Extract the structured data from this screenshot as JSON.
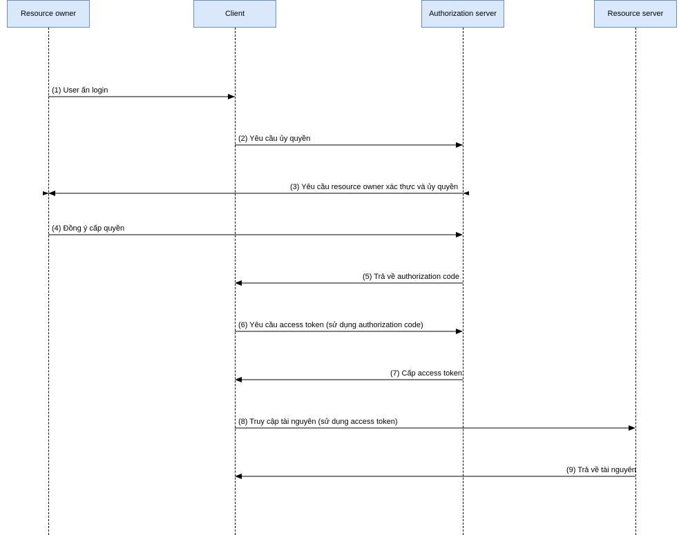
{
  "participants": {
    "resource_owner": "Resource owner",
    "client": "Client",
    "authorization_server": "Authorization server",
    "resource_server": "Resource server"
  },
  "messages": {
    "m1": "(1) User ấn login",
    "m2": "(2) Yêu cầu ủy quyền",
    "m3": "(3) Yêu cầu resource owner xác thực và ủy quyền",
    "m4": "(4) Đồng ý cấp quyền",
    "m5": "(5) Trả về authorization code",
    "m6": "(6) Yêu cầu access token (sử dụng authorization code)",
    "m7": "(7) Cấp access token",
    "m8": "(8) Truy cập tài nguyên (sử dụng access token)",
    "m9": "(9) Trả về tài nguyên"
  },
  "layout": {
    "x": {
      "resource_owner": 70,
      "client": 340,
      "authorization_server": 670,
      "resource_server": 920
    },
    "y": {
      "m1": 140,
      "m2": 210,
      "m3": 280,
      "m4": 340,
      "m5": 410,
      "m6": 480,
      "m7": 550,
      "m8": 620,
      "m9": 690
    }
  }
}
